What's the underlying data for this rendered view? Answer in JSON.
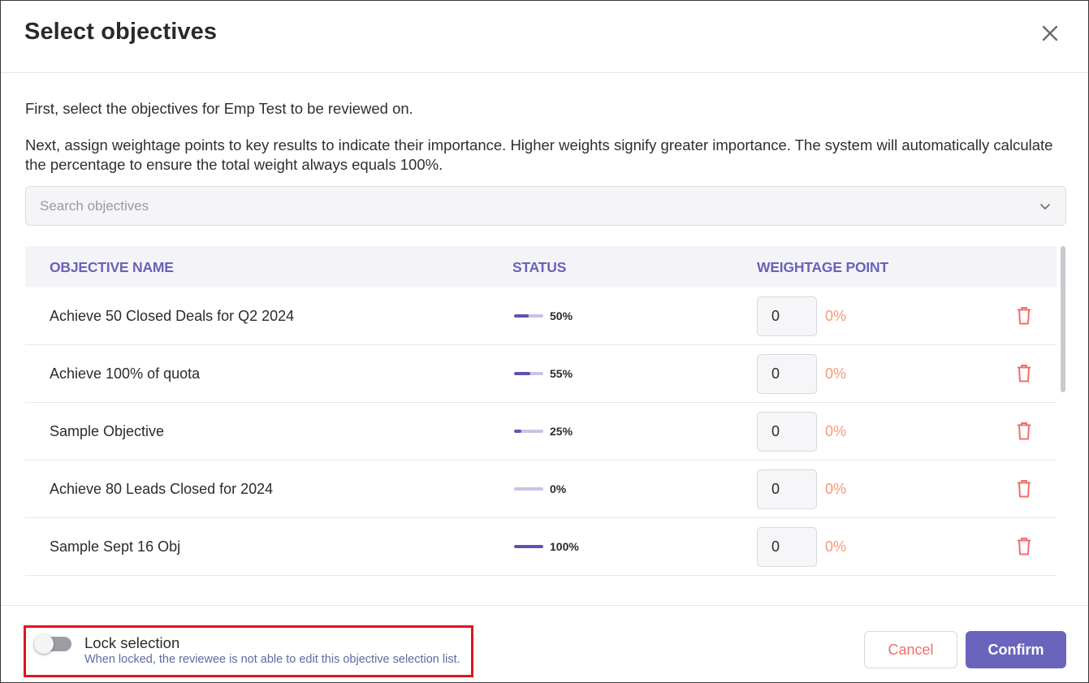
{
  "dialog": {
    "title": "Select objectives",
    "intro_line_1": "First, select the objectives for Emp Test to be reviewed on.",
    "intro_line_2": "Next, assign weightage points to key results to indicate their importance. Higher weights signify greater importance. The system will automatically calculate the percentage to ensure the total weight always equals 100%."
  },
  "search": {
    "placeholder": "Search objectives",
    "value": ""
  },
  "table": {
    "headers": {
      "name": "OBJECTIVE NAME",
      "status": "STATUS",
      "weight": "WEIGHTAGE POINT"
    },
    "rows": [
      {
        "name": "Achieve 50 Closed Deals for Q2 2024",
        "status_pct": "50%",
        "progress": 0.5,
        "weight": "0",
        "weight_pct": "0%"
      },
      {
        "name": "Achieve 100% of quota",
        "status_pct": "55%",
        "progress": 0.55,
        "weight": "0",
        "weight_pct": "0%"
      },
      {
        "name": "Sample Objective",
        "status_pct": "25%",
        "progress": 0.25,
        "weight": "0",
        "weight_pct": "0%"
      },
      {
        "name": "Achieve 80 Leads Closed for 2024",
        "status_pct": "0%",
        "progress": 0,
        "weight": "0",
        "weight_pct": "0%"
      },
      {
        "name": "Sample Sept 16 Obj",
        "status_pct": "100%",
        "progress": 1,
        "weight": "0",
        "weight_pct": "0%"
      }
    ]
  },
  "footer": {
    "lock_label": "Lock selection",
    "lock_description": "When locked, the reviewee is not able to edit this objective selection list.",
    "lock_enabled": false,
    "cancel_label": "Cancel",
    "confirm_label": "Confirm"
  },
  "colors": {
    "accent": "#6b64bd",
    "progress_fill": "#5b55ae",
    "progress_track": "#c8c4e6",
    "danger": "#ef6f6c",
    "weight_pct": "#f29a7a",
    "highlight_border": "#e0141e"
  },
  "icons": {
    "close": "close-icon",
    "chevron": "chevron-down-icon",
    "delete": "trash-icon"
  }
}
